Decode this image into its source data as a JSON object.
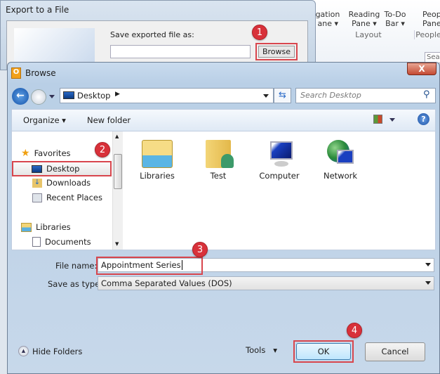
{
  "ribbon": {
    "items": [
      "vigation\nane ▾",
      "Reading\nPane ▾",
      "To-Do\nBar ▾",
      "Peop\nPane"
    ],
    "groups": [
      "Layout",
      "People"
    ],
    "search_partial": "Sear"
  },
  "export_dialog": {
    "title": "Export to a File",
    "save_label": "Save exported file as:",
    "path_value": "",
    "browse_label": "Browse ..."
  },
  "browse_dialog": {
    "title": "Browse",
    "close_label": "X",
    "address": "Desktop",
    "search_placeholder": "Search Desktop",
    "toolbar": {
      "organize": "Organize",
      "new_folder": "New folder"
    },
    "nav": {
      "favorites": "Favorites",
      "items": [
        "Desktop",
        "Downloads",
        "Recent Places"
      ],
      "libraries": "Libraries",
      "lib_items": [
        "Documents"
      ]
    },
    "files": [
      {
        "name": "Libraries",
        "icon": "libraries-icon"
      },
      {
        "name": "Test",
        "icon": "user-folder-icon"
      },
      {
        "name": "Computer",
        "icon": "computer-icon"
      },
      {
        "name": "Network",
        "icon": "network-icon"
      }
    ],
    "file_name_label": "File name:",
    "file_name_value": "Appointment Series",
    "save_type_label": "Save as type:",
    "save_type_value": "Comma Separated Values (DOS)",
    "hide_folders": "Hide Folders",
    "tools": "Tools",
    "ok": "OK",
    "cancel": "Cancel"
  },
  "steps": [
    "1",
    "2",
    "3",
    "4"
  ],
  "colors": {
    "highlight": "#d8464d",
    "badge": "#d8313a"
  }
}
